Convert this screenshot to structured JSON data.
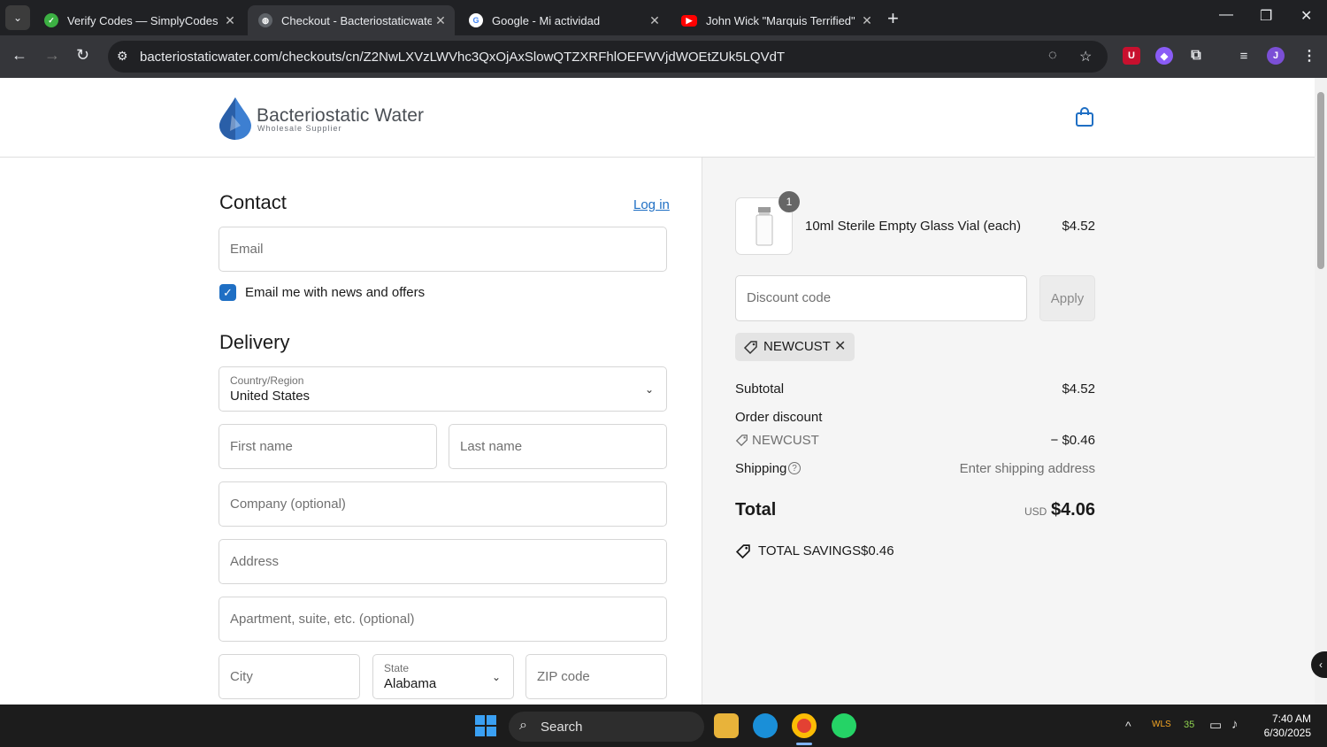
{
  "browser": {
    "tabs": [
      {
        "title": "Verify Codes — SimplyCodes",
        "active": false
      },
      {
        "title": "Checkout - Bacteriostaticwater.c",
        "active": true
      },
      {
        "title": "Google - Mi actividad",
        "active": false
      },
      {
        "title": "John Wick \"Marquis Terrified\"",
        "active": false
      }
    ],
    "url": "bacteriostaticwater.com/checkouts/cn/Z2NwLXVzLWVhc3QxOjAxSlowQTZXRFhlOEFWVjdWOEtZUk5LQVdT",
    "profile_initial": "J",
    "accent": "#1f6fc4"
  },
  "header": {
    "brand_name": "Bacteriostatic Water",
    "brand_tagline": "Wholesale Supplier"
  },
  "contact": {
    "title": "Contact",
    "login_link": "Log in",
    "email_placeholder": "Email",
    "newsletter_label": "Email me with news and offers",
    "newsletter_checked": true
  },
  "delivery": {
    "title": "Delivery",
    "country_label": "Country/Region",
    "country_value": "United States",
    "first_name_placeholder": "First name",
    "last_name_placeholder": "Last name",
    "company_placeholder": "Company (optional)",
    "address_placeholder": "Address",
    "apartment_placeholder": "Apartment, suite, etc. (optional)",
    "city_placeholder": "City",
    "state_label": "State",
    "state_value": "Alabama",
    "zip_placeholder": "ZIP code"
  },
  "summary": {
    "item_qty": "1",
    "item_name": "10ml Sterile Empty Glass Vial (each)",
    "item_price": "$4.52",
    "discount_placeholder": "Discount code",
    "apply_label": "Apply",
    "applied_code": "NEWCUST",
    "subtotal_label": "Subtotal",
    "subtotal_value": "$4.52",
    "order_discount_label": "Order discount",
    "discount_code": "NEWCUST",
    "discount_value": "− $0.46",
    "shipping_label": "Shipping",
    "shipping_value": "Enter shipping address",
    "total_label": "Total",
    "currency": "USD",
    "total_value": "$4.06",
    "savings_label": "TOTAL SAVINGS",
    "savings_value": "$0.46"
  },
  "taskbar": {
    "search_label": "Search",
    "time": "7:40 AM",
    "date": "6/30/2025",
    "tray_stock": "WLS",
    "tray_temp": "35"
  }
}
